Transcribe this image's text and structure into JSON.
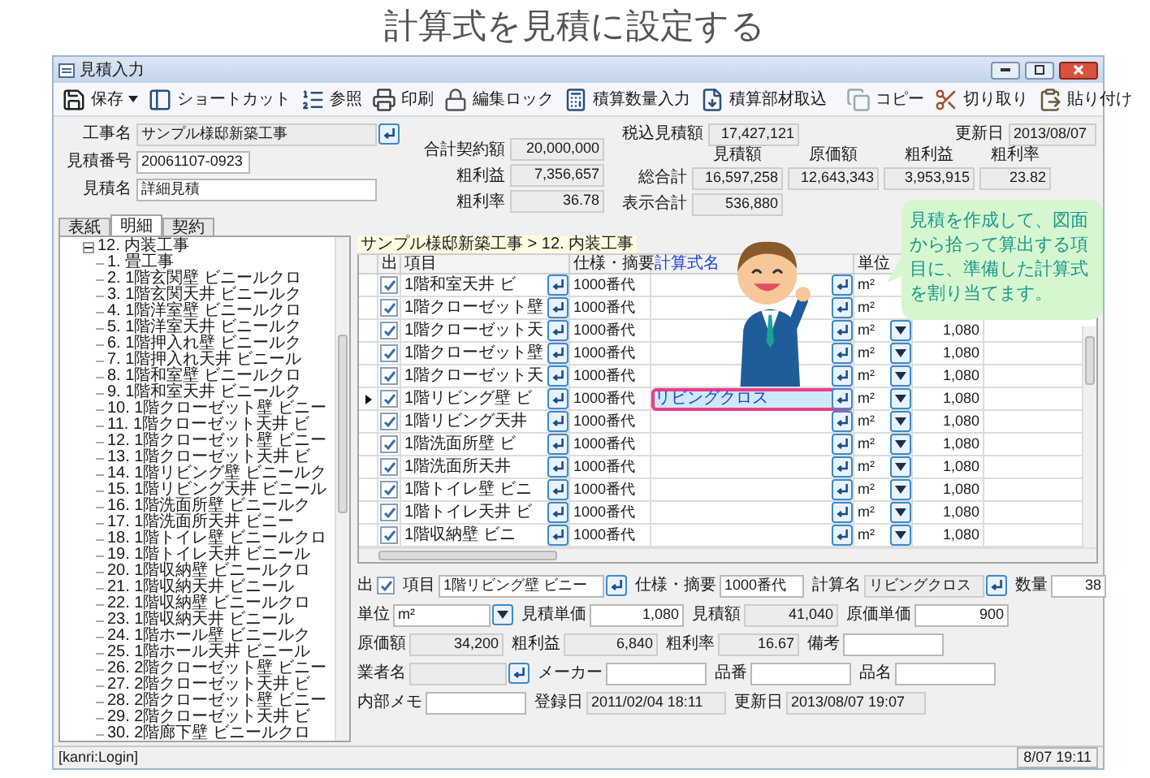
{
  "page_title": "計算式を見積に設定する",
  "window": {
    "title": "見積入力"
  },
  "toolbar": {
    "main": [
      {
        "kind": "save",
        "label": "保存",
        "has_menu": true
      },
      {
        "kind": "shortcut",
        "label": "ショートカット",
        "has_menu": false
      },
      {
        "kind": "reference",
        "label": "参照",
        "has_menu": false
      },
      {
        "kind": "print",
        "label": "印刷",
        "has_menu": false
      },
      {
        "kind": "lock",
        "label": "編集ロック",
        "has_menu": false
      },
      {
        "kind": "quantity",
        "label": "積算数量入力",
        "has_menu": false
      },
      {
        "kind": "import",
        "label": "積算部材取込",
        "has_menu": false
      }
    ],
    "edit": [
      {
        "kind": "copy",
        "label": "コピー",
        "has_menu": false
      },
      {
        "kind": "cut",
        "label": "切り取り",
        "has_menu": false
      },
      {
        "kind": "paste",
        "label": "貼り付け",
        "has_menu": false
      }
    ]
  },
  "header": {
    "left": [
      {
        "label": "工事名",
        "value": "サンプル様邸新築工事",
        "kind": "readonly_lookup"
      },
      {
        "label": "見積番号",
        "value": "20061107-0923",
        "kind": "text"
      },
      {
        "label": "見積名",
        "value": "詳細見積",
        "kind": "text"
      }
    ],
    "middle": [
      {
        "label": "合計契約額",
        "value": "20,000,000",
        "kind": "readonly_number"
      },
      {
        "label": "粗利益",
        "value": "7,356,657",
        "kind": "readonly_number"
      },
      {
        "label": "粗利率",
        "value": "36.78",
        "kind": "readonly_number"
      }
    ],
    "tax_included": {
      "label": "税込見積額",
      "value": "17,427,121"
    },
    "updated": {
      "label": "更新日",
      "value": "2013/08/07"
    },
    "summary": {
      "columns": [
        "見積額",
        "原価額",
        "粗利益",
        "粗利率"
      ],
      "rows": [
        {
          "label": "総合計",
          "values": [
            "16,597,258",
            "12,643,343",
            "3,953,915",
            "23.82"
          ]
        },
        {
          "label": "表示合計",
          "values": [
            "536,880"
          ]
        }
      ]
    }
  },
  "tabs": [
    {
      "label": "表紙",
      "selected": false
    },
    {
      "label": "明細",
      "selected": true
    },
    {
      "label": "契約",
      "selected": false
    }
  ],
  "tree": [
    {
      "label": "12. 内装工事",
      "expanded": true,
      "children": [
        {
          "label": "1. 畳工事"
        },
        {
          "label": "2. 1階玄関壁 ビニールクロ"
        },
        {
          "label": "3. 1階玄関天井 ビニールク"
        },
        {
          "label": "4. 1階洋室壁 ビニールクロ"
        },
        {
          "label": "5. 1階洋室天井 ビニールク"
        },
        {
          "label": "6. 1階押入れ壁 ビニールク"
        },
        {
          "label": "7. 1階押入れ天井 ビニール"
        },
        {
          "label": "8. 1階和室壁 ビニールクロ"
        },
        {
          "label": "9. 1階和室天井 ビニールク"
        },
        {
          "label": "10. 1階クローゼット壁 ビニー"
        },
        {
          "label": "11. 1階クローゼット天井 ビ"
        },
        {
          "label": "12. 1階クローゼット壁 ビニー"
        },
        {
          "label": "13. 1階クローゼット天井 ビ"
        },
        {
          "label": "14. 1階リビング壁 ビニールク"
        },
        {
          "label": "15. 1階リビング天井 ビニール"
        },
        {
          "label": "16. 1階洗面所壁 ビニールク"
        },
        {
          "label": "17. 1階洗面所天井 ビニー"
        },
        {
          "label": "18. 1階トイレ壁 ビニールクロ"
        },
        {
          "label": "19. 1階トイレ天井 ビニール"
        },
        {
          "label": "20. 1階収納壁 ビニールクロ"
        },
        {
          "label": "21. 1階収納天井 ビニール"
        },
        {
          "label": "22. 1階収納壁 ビニールクロ"
        },
        {
          "label": "23. 1階収納天井 ビニール"
        },
        {
          "label": "24. 1階ホール壁 ビニールク"
        },
        {
          "label": "25. 1階ホール天井 ビニール"
        },
        {
          "label": "26. 2階クローゼット壁 ビニー"
        },
        {
          "label": "27. 2階クローゼット天井 ビ"
        },
        {
          "label": "28. 2階クローゼット壁 ビニー"
        },
        {
          "label": "29. 2階クローゼット天井 ビ"
        },
        {
          "label": "30. 2階廊下壁 ビニールクロ"
        }
      ]
    }
  ],
  "breadcrumb": "サンプル様邸新築工事 > 12. 内装工事",
  "table": {
    "columns": [
      {
        "label": "出",
        "kind": "plain"
      },
      {
        "label": "項目",
        "kind": "plain"
      },
      {
        "label": "仕様・摘要",
        "kind": "plain"
      },
      {
        "label": "計算式名",
        "kind": "lookup"
      },
      {
        "label": "単位",
        "kind": "plain"
      }
    ],
    "rows": [
      {
        "selected": false,
        "output": true,
        "item": "1階和室天井 ビ",
        "spec": "1000番代",
        "unit": "m²"
      },
      {
        "selected": false,
        "output": true,
        "item": "1階クローゼット壁",
        "spec": "1000番代",
        "unit": "m²"
      },
      {
        "selected": false,
        "output": true,
        "item": "1階クローゼット天",
        "spec": "1000番代",
        "unit": "m²",
        "price": "1,080"
      },
      {
        "selected": false,
        "output": true,
        "item": "1階クローゼット壁",
        "spec": "1000番代",
        "unit": "m²",
        "price": "1,080"
      },
      {
        "selected": false,
        "output": true,
        "item": "1階クローゼット天",
        "spec": "1000番代",
        "unit": "m²",
        "price": "1,080"
      },
      {
        "selected": true,
        "output": true,
        "item": "1階リビング壁 ビ",
        "spec": "1000番代",
        "formula": "リビングクロス",
        "unit": "m²",
        "price": "1,080"
      },
      {
        "selected": false,
        "output": true,
        "item": "1階リビング天井",
        "spec": "1000番代",
        "unit": "m²",
        "price": "1,080"
      },
      {
        "selected": false,
        "output": true,
        "item": "1階洗面所壁 ビ",
        "spec": "1000番代",
        "unit": "m²",
        "price": "1,080"
      },
      {
        "selected": false,
        "output": true,
        "item": "1階洗面所天井",
        "spec": "1000番代",
        "unit": "m²",
        "price": "1,080"
      },
      {
        "selected": false,
        "output": true,
        "item": "1階トイレ壁 ビニ",
        "spec": "1000番代",
        "unit": "m²",
        "price": "1,080"
      },
      {
        "selected": false,
        "output": true,
        "item": "1階トイレ天井 ビ",
        "spec": "1000番代",
        "unit": "m²",
        "price": "1,080"
      },
      {
        "selected": false,
        "output": true,
        "item": "1階収納壁 ビニ",
        "spec": "1000番代",
        "unit": "m²",
        "price": "1,080"
      }
    ]
  },
  "detail_form": [
    [
      {
        "label": "出",
        "kind": "check",
        "checked": true
      },
      {
        "label": "項目",
        "kind": "lookup",
        "value": "1階リビング壁 ビニー"
      },
      {
        "label": "仕様・摘要",
        "kind": "text",
        "value": "1000番代"
      },
      {
        "label": "計算名",
        "kind": "readonly_lookup",
        "value": "リビングクロス"
      },
      {
        "label": "数量",
        "kind": "number",
        "value": "38"
      }
    ],
    [
      {
        "label": "単位",
        "kind": "dropdown",
        "value": "m²"
      },
      {
        "label": "見積単価",
        "kind": "number",
        "value": "1,080"
      },
      {
        "label": "見積額",
        "kind": "readonly_number",
        "value": "41,040"
      },
      {
        "label": "原価単価",
        "kind": "number",
        "value": "900"
      }
    ],
    [
      {
        "label": "原価額",
        "kind": "readonly_number",
        "value": "34,200"
      },
      {
        "label": "粗利益",
        "kind": "readonly_number",
        "value": "6,840"
      },
      {
        "label": "粗利率",
        "kind": "readonly_number",
        "value": "16.67"
      },
      {
        "label": "備考",
        "kind": "text"
      }
    ],
    [
      {
        "label": "業者名",
        "kind": "readonly_lookup"
      },
      {
        "label": "メーカー",
        "kind": "text"
      },
      {
        "label": "品番",
        "kind": "text"
      },
      {
        "label": "品名",
        "kind": "text"
      }
    ],
    [
      {
        "label": "内部メモ",
        "kind": "text"
      },
      {
        "label": "登録日",
        "kind": "readonly",
        "value": "2011/02/04 18:11"
      },
      {
        "label": "更新日",
        "kind": "readonly",
        "value": "2013/08/07 19:07"
      }
    ]
  ],
  "status_bar": {
    "user": "[kanri:Login]",
    "clock": "8/07 19:11"
  },
  "callout": {
    "text": "見積を作成して、図面から拾って算出する項目に、準備した計算式を割り当てます。"
  }
}
